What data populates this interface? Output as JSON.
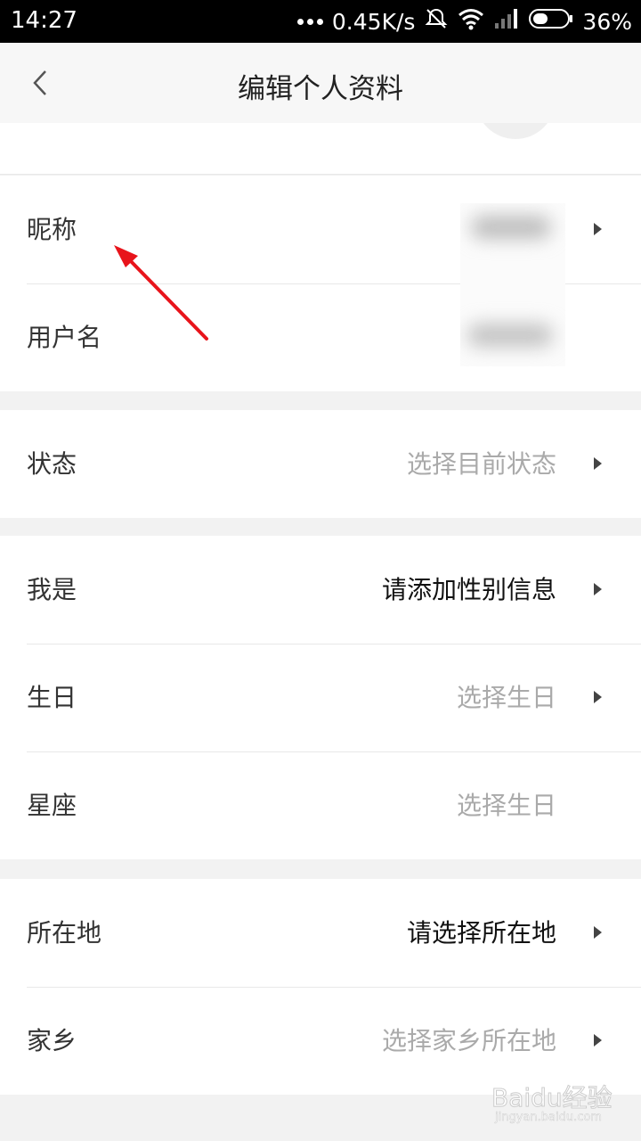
{
  "status_bar": {
    "time": "14:27",
    "network_speed": "0.45K/s",
    "battery": "36%",
    "icons": [
      "more-dots-icon",
      "mute-icon",
      "wifi-icon",
      "signal-icon",
      "battery-icon"
    ]
  },
  "nav": {
    "title": "编辑个人资料",
    "back_icon": "chevron-left-icon"
  },
  "basic": {
    "nickname_label": "昵称",
    "username_label": "用户名"
  },
  "status_section": {
    "label": "状态",
    "placeholder": "选择目前状态"
  },
  "profile": {
    "gender_label": "我是",
    "gender_value": "请添加性别信息",
    "birthday_label": "生日",
    "birthday_placeholder": "选择生日",
    "zodiac_label": "星座",
    "zodiac_placeholder": "选择生日"
  },
  "location": {
    "location_label": "所在地",
    "location_value": "请选择所在地",
    "hometown_label": "家乡",
    "hometown_placeholder": "选择家乡所在地"
  },
  "annotation": {
    "arrow_color": "#e8141b"
  },
  "watermark": {
    "text": "Baidu经验",
    "url": "jingyan.baidu.com"
  },
  "colors": {
    "page_bg": "#f2f2f2",
    "placeholder": "#aaaaaa",
    "value_text": "#111111"
  }
}
